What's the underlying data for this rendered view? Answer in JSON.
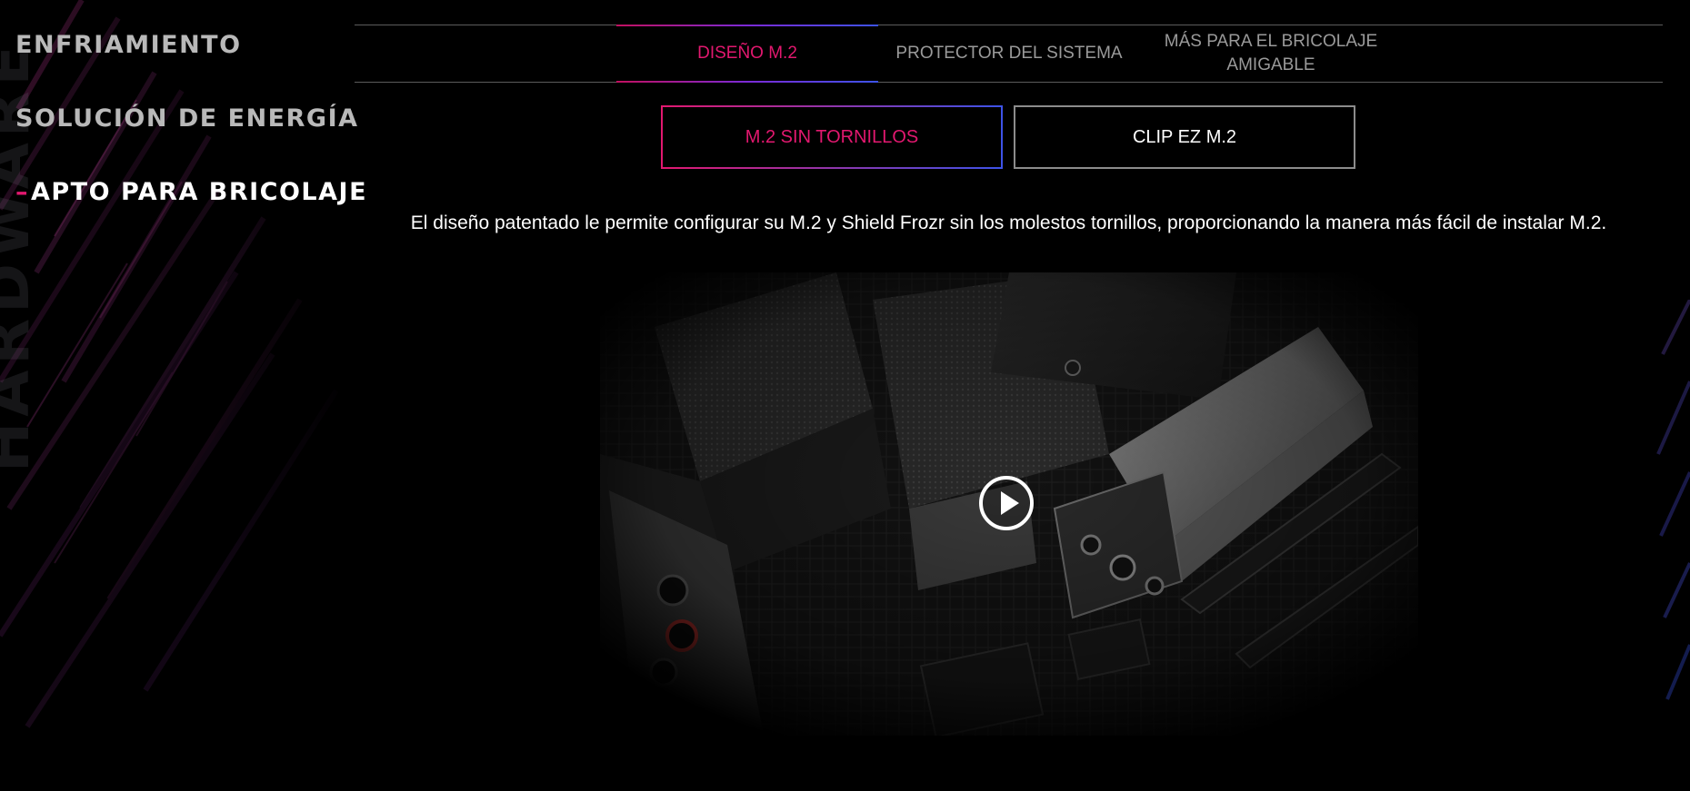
{
  "sidebar": {
    "items": [
      {
        "label": "ENFRIAMIENTO",
        "active": false
      },
      {
        "label": "SOLUCIÓN DE ENERGÍA",
        "active": false
      },
      {
        "label": "APTO PARA BRICOLAJE",
        "active": true,
        "prefix": "–"
      }
    ]
  },
  "background": {
    "vertical_word": "HARDWARE"
  },
  "tabs": [
    {
      "label": "DISEÑO M.2",
      "active": true
    },
    {
      "label": "PROTECTOR DEL SISTEMA",
      "active": false
    },
    {
      "label": "MÁS PARA EL BRICOLAJE AMIGABLE",
      "active": false
    }
  ],
  "sub_buttons": [
    {
      "label": "M.2 SIN TORNILLOS",
      "active": true
    },
    {
      "label": "CLIP EZ M.2",
      "active": false
    }
  ],
  "description": "El diseño patentado le permite configurar su M.2 y Shield Frozr sin los molestos tornillos, proporcionando la manera más fácil de instalar M.2.",
  "video": {
    "play_icon": "play-circle-icon",
    "subject": "motherboard M.2 slot close-up"
  },
  "colors": {
    "accent": "#e2186f",
    "gradient_end": "#3d53e8",
    "background": "#000000",
    "inactive_text": "#9a9a9a",
    "sidebar_text": "#b9b9b9"
  }
}
